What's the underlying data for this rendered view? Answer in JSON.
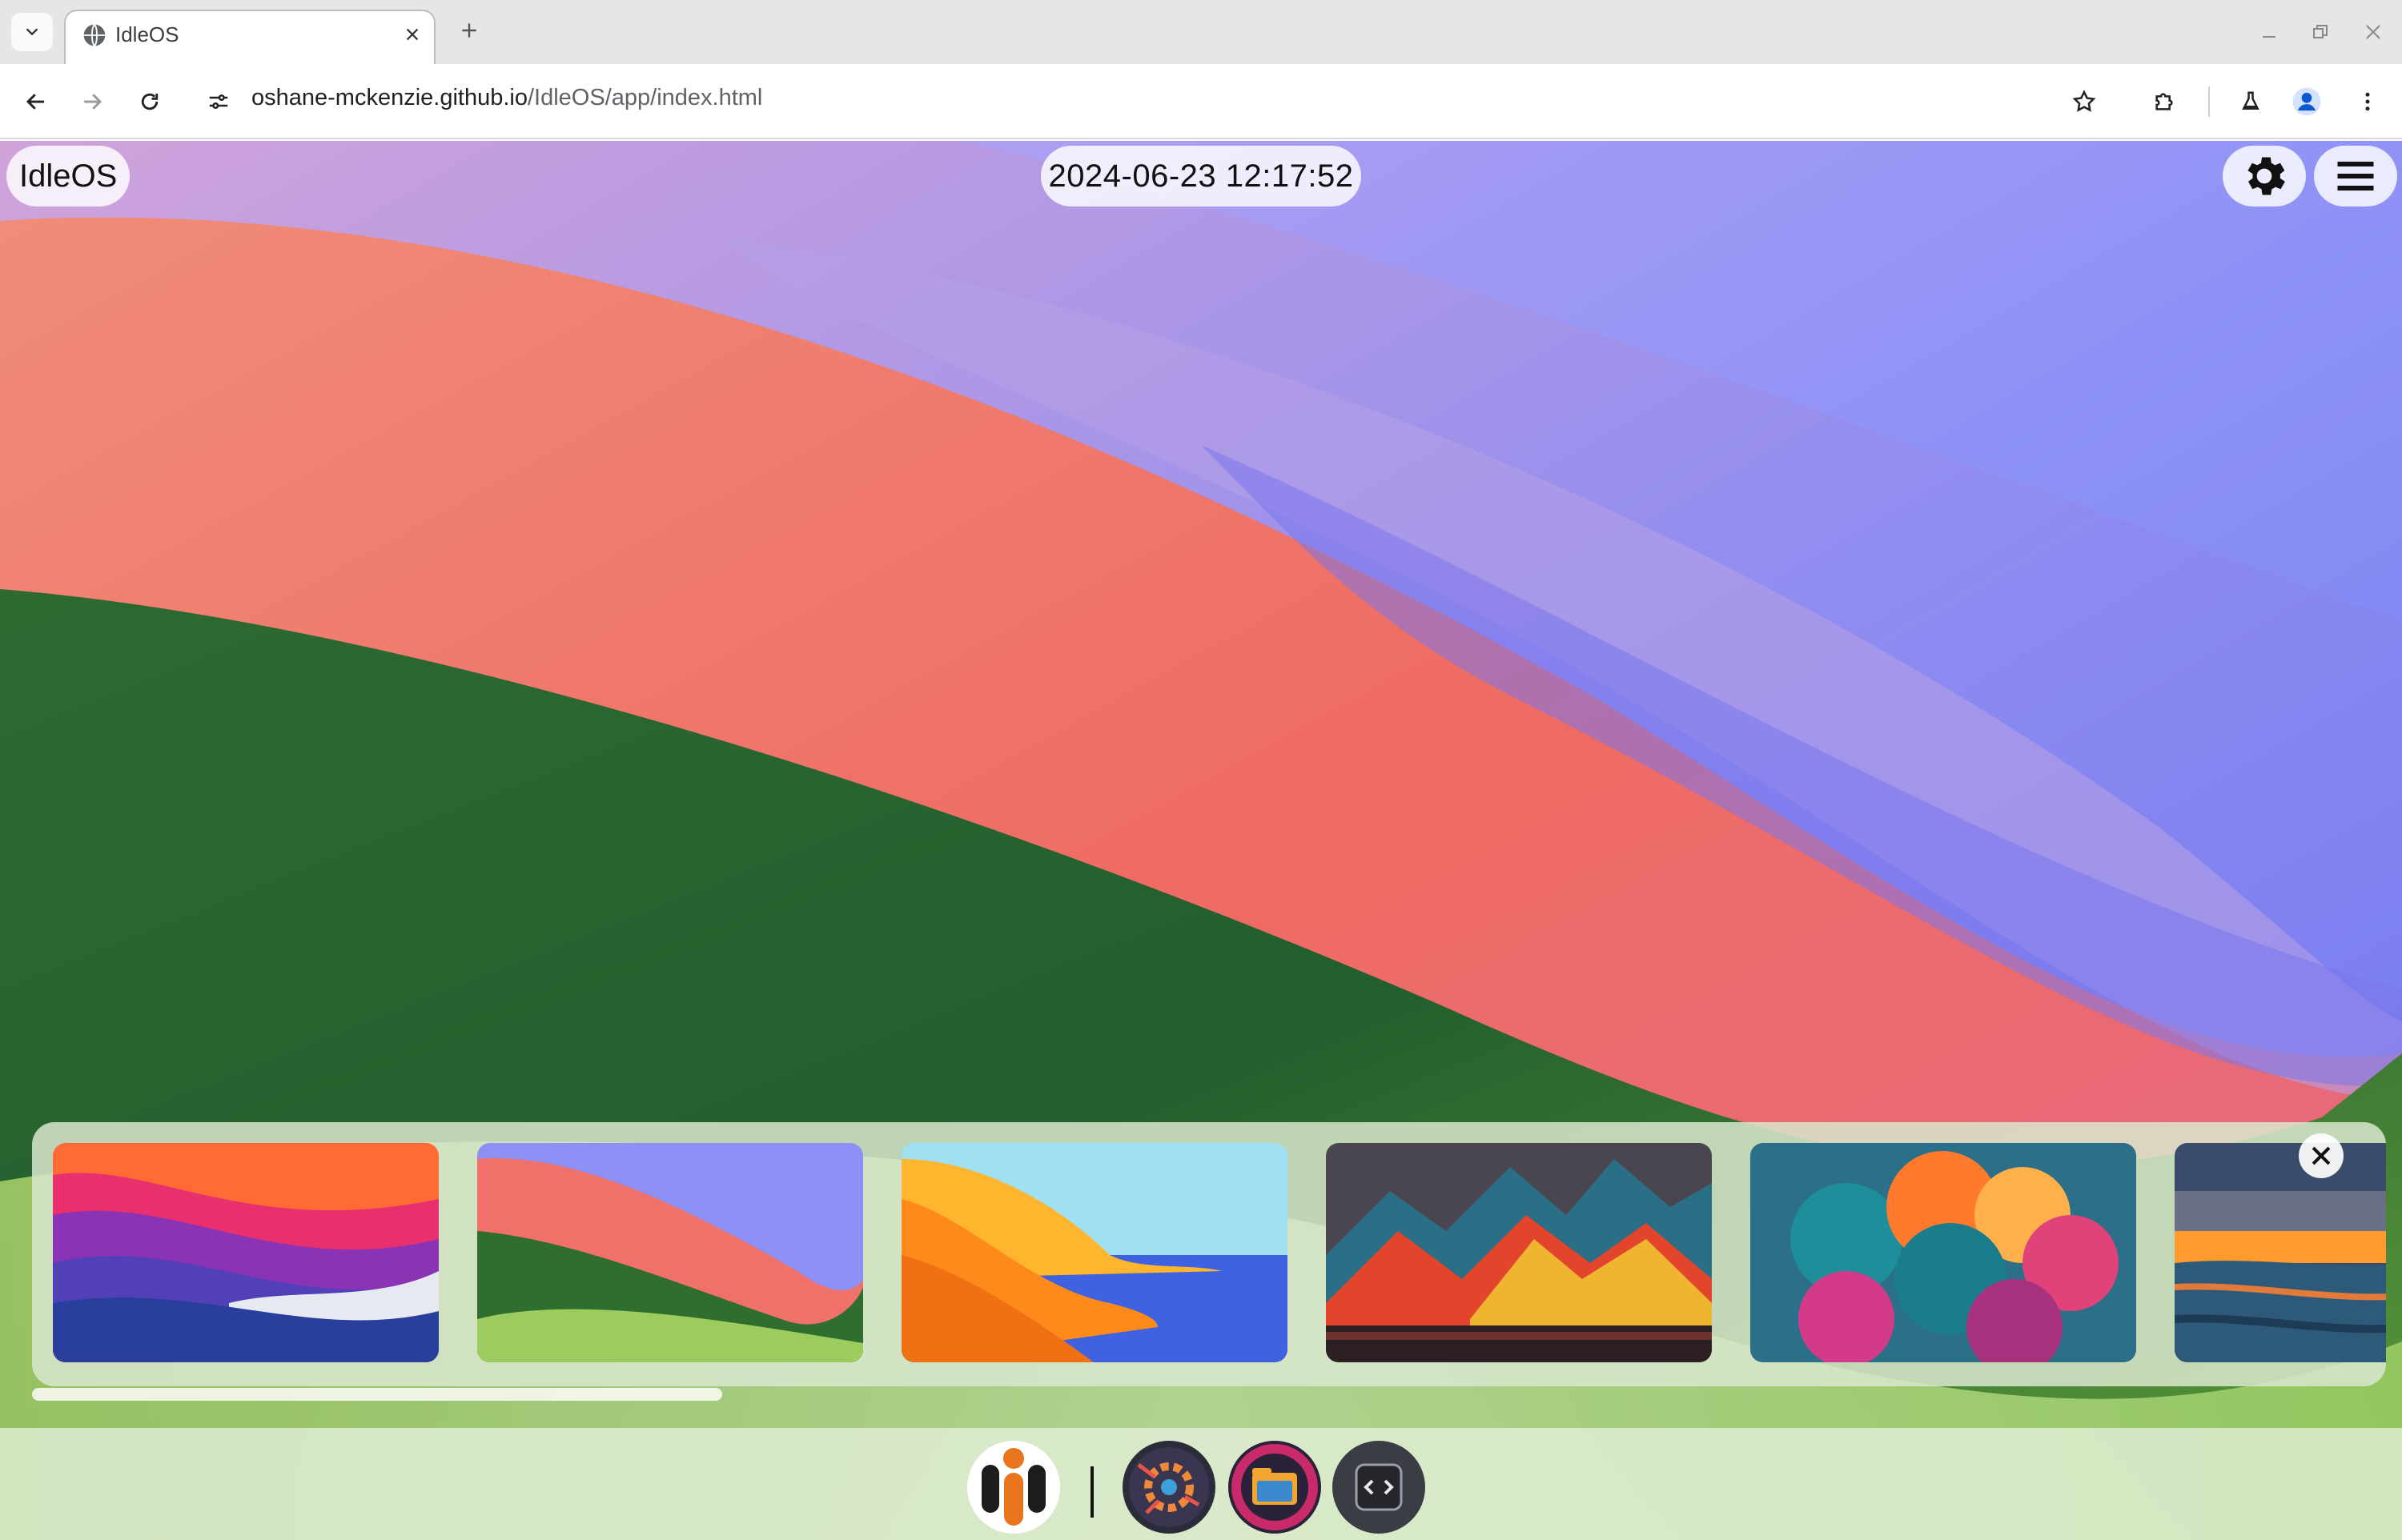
{
  "browser": {
    "tab": {
      "title": "IdleOS",
      "favicon": "globe-icon"
    },
    "address": {
      "host": "oshane-mckenzie.github.io",
      "path": "/IdleOS/app/index.html"
    },
    "icons": {
      "tab_list": "chevron-down-icon",
      "tab_close": "close-icon",
      "new_tab": "plus-icon",
      "back": "arrow-left-icon",
      "forward": "arrow-right-icon",
      "reload": "reload-icon",
      "site_info": "tune-icon",
      "bookmark": "star-icon",
      "extensions": "puzzle-icon",
      "labs": "flask-icon",
      "profile": "person-icon",
      "menu": "kebab-icon"
    }
  },
  "desktop": {
    "brand": "IdleOS",
    "clock": "2024-06-23 12:17:52",
    "settings_icon": "gear-icon",
    "menu_icon": "hamburger-icon"
  },
  "wallpaper_picker": {
    "thumbnails": [
      {
        "name": "wallpaper-waves-purple",
        "colors": [
          "#2a3f9c",
          "#8a33b5",
          "#ff5a3d"
        ]
      },
      {
        "name": "wallpaper-sonoma",
        "colors": [
          "#3f8a2b",
          "#f0706a",
          "#8d90f5"
        ]
      },
      {
        "name": "wallpaper-coast",
        "colors": [
          "#ff8a1c",
          "#ffb52e",
          "#3f62e0"
        ]
      },
      {
        "name": "wallpaper-mountains",
        "colors": [
          "#3a3840",
          "#e2452c",
          "#f0b530"
        ]
      },
      {
        "name": "wallpaper-clouds",
        "colors": [
          "#1e8f9a",
          "#ff7a2c",
          "#d33a8a"
        ]
      },
      {
        "name": "wallpaper-sunset-field",
        "colors": [
          "#3b4b6a",
          "#ff9a2e",
          "#2e5a7a"
        ]
      }
    ],
    "close_icon": "close-icon"
  },
  "dock": {
    "launcher_icon": "idleos-logo-icon",
    "apps": [
      {
        "name": "settings-app-icon"
      },
      {
        "name": "files-app-icon"
      },
      {
        "name": "code-app-icon"
      }
    ]
  },
  "colors": {
    "picker_bg": "#d8e6cd",
    "dock_bg": "#e2eed6",
    "pill_bg": "#ffffff"
  }
}
